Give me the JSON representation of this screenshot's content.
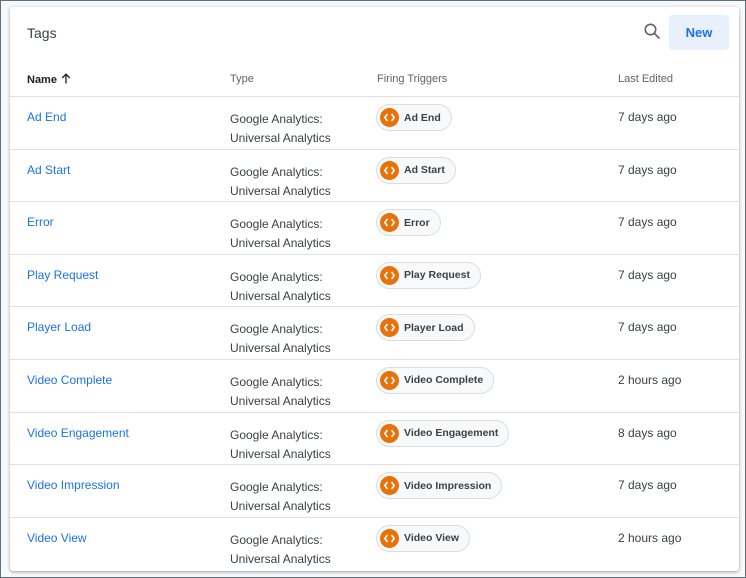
{
  "header": {
    "title": "Tags",
    "new_label": "New"
  },
  "columns": {
    "name": "Name",
    "type": "Type",
    "triggers": "Firing Triggers",
    "last_edited": "Last Edited"
  },
  "sort": {
    "column": "name",
    "direction": "ascending",
    "icon": "arrow-up-icon"
  },
  "colors": {
    "link": "#1a73e8",
    "trigger_icon": "#e8710a",
    "new_button_bg": "#e8f0fe"
  },
  "rows": [
    {
      "name": "Ad End",
      "type": "Google Analytics: Universal Analytics",
      "trigger": "Ad End",
      "last_edited": "7 days ago"
    },
    {
      "name": "Ad Start",
      "type": "Google Analytics: Universal Analytics",
      "trigger": "Ad Start",
      "last_edited": "7 days ago"
    },
    {
      "name": "Error",
      "type": "Google Analytics: Universal Analytics",
      "trigger": "Error",
      "last_edited": "7 days ago"
    },
    {
      "name": "Play Request",
      "type": "Google Analytics: Universal Analytics",
      "trigger": "Play Request",
      "last_edited": "7 days ago"
    },
    {
      "name": "Player Load",
      "type": "Google Analytics: Universal Analytics",
      "trigger": "Player Load",
      "last_edited": "7 days ago"
    },
    {
      "name": "Video Complete",
      "type": "Google Analytics: Universal Analytics",
      "trigger": "Video Complete",
      "last_edited": "2 hours ago"
    },
    {
      "name": "Video Engagement",
      "type": "Google Analytics: Universal Analytics",
      "trigger": "Video Engagement",
      "last_edited": "8 days ago"
    },
    {
      "name": "Video Impression",
      "type": "Google Analytics: Universal Analytics",
      "trigger": "Video Impression",
      "last_edited": "7 days ago"
    },
    {
      "name": "Video View",
      "type": "Google Analytics: Universal Analytics",
      "trigger": "Video View",
      "last_edited": "2 hours ago"
    }
  ]
}
